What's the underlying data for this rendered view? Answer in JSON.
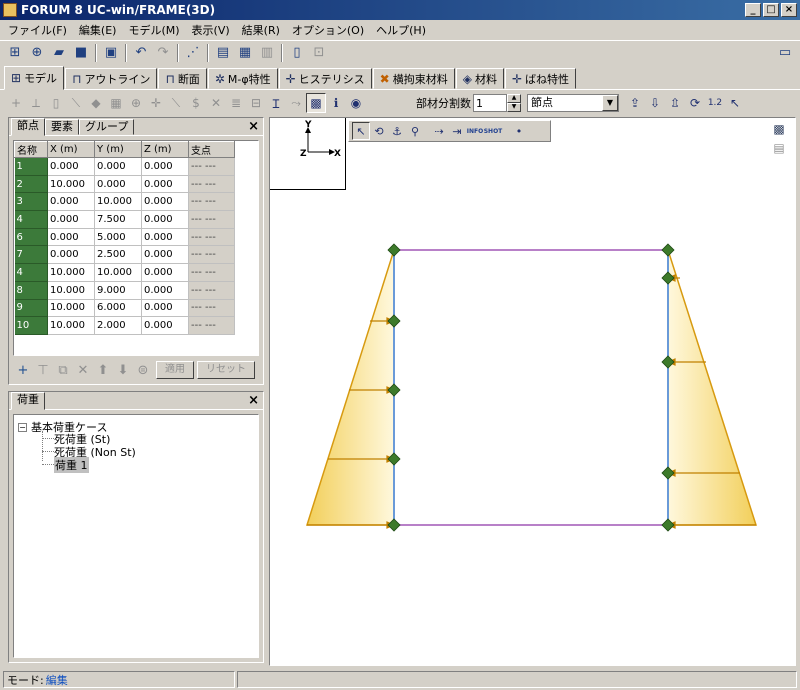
{
  "window": {
    "title": "FORUM 8  UC-win/FRAME(3D)",
    "minimize_glyph": "_",
    "maximize_glyph": "□",
    "close_glyph": "×"
  },
  "menu": [
    "ファイル(F)",
    "編集(E)",
    "モデル(M)",
    "表示(V)",
    "結果(R)",
    "オプション(O)",
    "ヘルプ(H)"
  ],
  "tabs": [
    {
      "label": "モデル",
      "icon": "model-icon",
      "glyph": "⊞"
    },
    {
      "label": "アウトライン",
      "icon": "outline-icon",
      "glyph": "⊓"
    },
    {
      "label": "断面",
      "icon": "section-icon",
      "glyph": "⊓"
    },
    {
      "label": "M-φ特性",
      "icon": "m-phi-icon",
      "glyph": "✲"
    },
    {
      "label": "ヒステリシス",
      "icon": "hysteresis-icon",
      "glyph": "✛"
    },
    {
      "label": "横拘束材料",
      "icon": "confinement-icon",
      "glyph": "✖"
    },
    {
      "label": "材料",
      "icon": "material-icon",
      "glyph": "◈"
    },
    {
      "label": "ばね特性",
      "icon": "spring-icon",
      "glyph": "✛"
    }
  ],
  "toolbar2": {
    "split_label": "部材分割数",
    "split_value": "1",
    "target_value": "節点"
  },
  "node_panel": {
    "tabs": [
      "節点",
      "要素",
      "グループ"
    ],
    "close": "×",
    "columns": [
      "名称",
      "X (m)",
      "Y (m)",
      "Z (m)",
      "支点"
    ],
    "rows": [
      {
        "name": "1",
        "x": "0.000",
        "y": "0.000",
        "z": "0.000",
        "support": "--- ---"
      },
      {
        "name": "2",
        "x": "10.000",
        "y": "0.000",
        "z": "0.000",
        "support": "--- ---"
      },
      {
        "name": "3",
        "x": "0.000",
        "y": "10.000",
        "z": "0.000",
        "support": "--- ---"
      },
      {
        "name": "4",
        "x": "0.000",
        "y": "7.500",
        "z": "0.000",
        "support": "--- ---"
      },
      {
        "name": "6",
        "x": "0.000",
        "y": "5.000",
        "z": "0.000",
        "support": "--- ---"
      },
      {
        "name": "7",
        "x": "0.000",
        "y": "2.500",
        "z": "0.000",
        "support": "--- ---"
      },
      {
        "name": "4",
        "x": "10.000",
        "y": "10.000",
        "z": "0.000",
        "support": "--- ---"
      },
      {
        "name": "8",
        "x": "10.000",
        "y": "9.000",
        "z": "0.000",
        "support": "--- ---"
      },
      {
        "name": "9",
        "x": "10.000",
        "y": "6.000",
        "z": "0.000",
        "support": "--- ---"
      },
      {
        "name": "10",
        "x": "10.000",
        "y": "2.000",
        "z": "0.000",
        "support": "--- ---"
      }
    ],
    "apply_label": "適用",
    "reset_label": "リセット"
  },
  "load_panel": {
    "tab": "荷重",
    "close": "×",
    "root": "基本荷重ケース",
    "children": [
      "死荷重 (St)",
      "死荷重 (Non St)",
      "荷重 1"
    ],
    "expander": "−"
  },
  "view": {
    "axis_y": "Y",
    "axis_z": "Z",
    "axis_x": "X",
    "info_label": "INFO",
    "shot_label": "SHOT"
  },
  "status": {
    "mode_label": "モード:",
    "mode_value": "編集"
  },
  "colors": {
    "node": "#3d7a2a",
    "frame_blue": "#6a9ad8",
    "frame_purple": "#b880c8",
    "load_fill": "#f5d56a",
    "load_edge": "#d79a10"
  }
}
